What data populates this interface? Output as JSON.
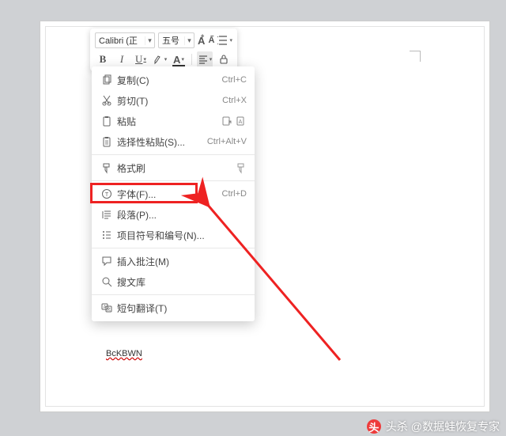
{
  "toolbar": {
    "font_name": "Calibri (正",
    "font_size": "五号",
    "grow_label": "A",
    "shrink_label": "A",
    "bold": "B",
    "italic": "I",
    "underline": "U",
    "highlight": "A",
    "font_color": "A"
  },
  "menu": {
    "copy": {
      "label": "复制(C)",
      "shortcut": "Ctrl+C"
    },
    "cut": {
      "label": "剪切(T)",
      "shortcut": "Ctrl+X"
    },
    "paste": {
      "label": "粘贴",
      "shortcut": ""
    },
    "paste_sel": {
      "label": "选择性粘贴(S)...",
      "shortcut": "Ctrl+Alt+V"
    },
    "fmt_paint": {
      "label": "格式刷",
      "shortcut": ""
    },
    "font": {
      "label": "字体(F)...",
      "shortcut": "Ctrl+D"
    },
    "paragraph": {
      "label": "段落(P)...",
      "shortcut": ""
    },
    "bullets": {
      "label": "项目符号和编号(N)...",
      "shortcut": ""
    },
    "comment": {
      "label": "插入批注(M)",
      "shortcut": ""
    },
    "thesaurus": {
      "label": "搜文库",
      "shortcut": ""
    },
    "translate": {
      "label": "短句翻译(T)",
      "shortcut": ""
    }
  },
  "document": {
    "body_text": "BcKBWN"
  },
  "watermark": {
    "prefix": "头杀",
    "at": "@数据蛙恢复专家"
  }
}
